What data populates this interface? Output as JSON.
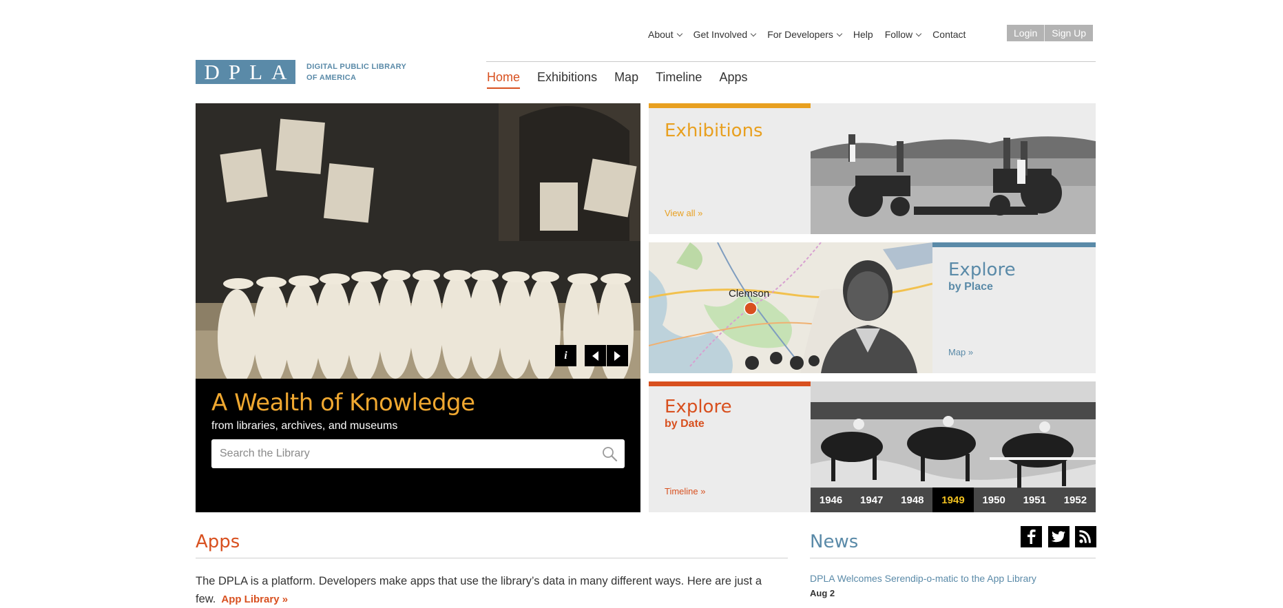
{
  "utility_nav": {
    "items": [
      {
        "label": "About",
        "dropdown": true
      },
      {
        "label": "Get Involved",
        "dropdown": true
      },
      {
        "label": "For Developers",
        "dropdown": true
      },
      {
        "label": "Help",
        "dropdown": false
      },
      {
        "label": "Follow",
        "dropdown": true
      },
      {
        "label": "Contact",
        "dropdown": false
      }
    ],
    "login": "Login",
    "signup": "Sign Up"
  },
  "logo": {
    "letters": [
      "D",
      "P",
      "L",
      "A"
    ],
    "line1": "DIGITAL PUBLIC LIBRARY",
    "line2": "OF AMERICA"
  },
  "main_nav": {
    "items": [
      "Home",
      "Exhibitions",
      "Map",
      "Timeline",
      "Apps"
    ],
    "active": "Home"
  },
  "hero": {
    "title": "A Wealth of Knowledge",
    "subtitle": "from libraries, archives, and museums",
    "info_label": "i",
    "search_placeholder": "Search the Library"
  },
  "tiles": {
    "exhibitions": {
      "title": "Exhibitions",
      "link": "View all »"
    },
    "place": {
      "title": "Explore",
      "subtitle": "by Place",
      "link": "Map »",
      "map_label": "Clemson"
    },
    "date": {
      "title": "Explore",
      "subtitle": "by Date",
      "link": "Timeline »",
      "years": [
        "1946",
        "1947",
        "1948",
        "1949",
        "1950",
        "1951",
        "1952"
      ],
      "selected_year": "1949"
    }
  },
  "apps": {
    "heading": "Apps",
    "text": "The DPLA is a platform. Developers make apps that use the library’s data in many different ways. Here are just a few.",
    "link": "App Library »"
  },
  "news": {
    "heading": "News",
    "items": [
      {
        "title": "DPLA Welcomes Serendip-o-matic to the App Library",
        "date": "Aug 2"
      }
    ]
  },
  "colors": {
    "orange": "#d8501f",
    "gold": "#e8a020",
    "blue": "#5a8aa8",
    "tile_bg": "#ececec"
  }
}
